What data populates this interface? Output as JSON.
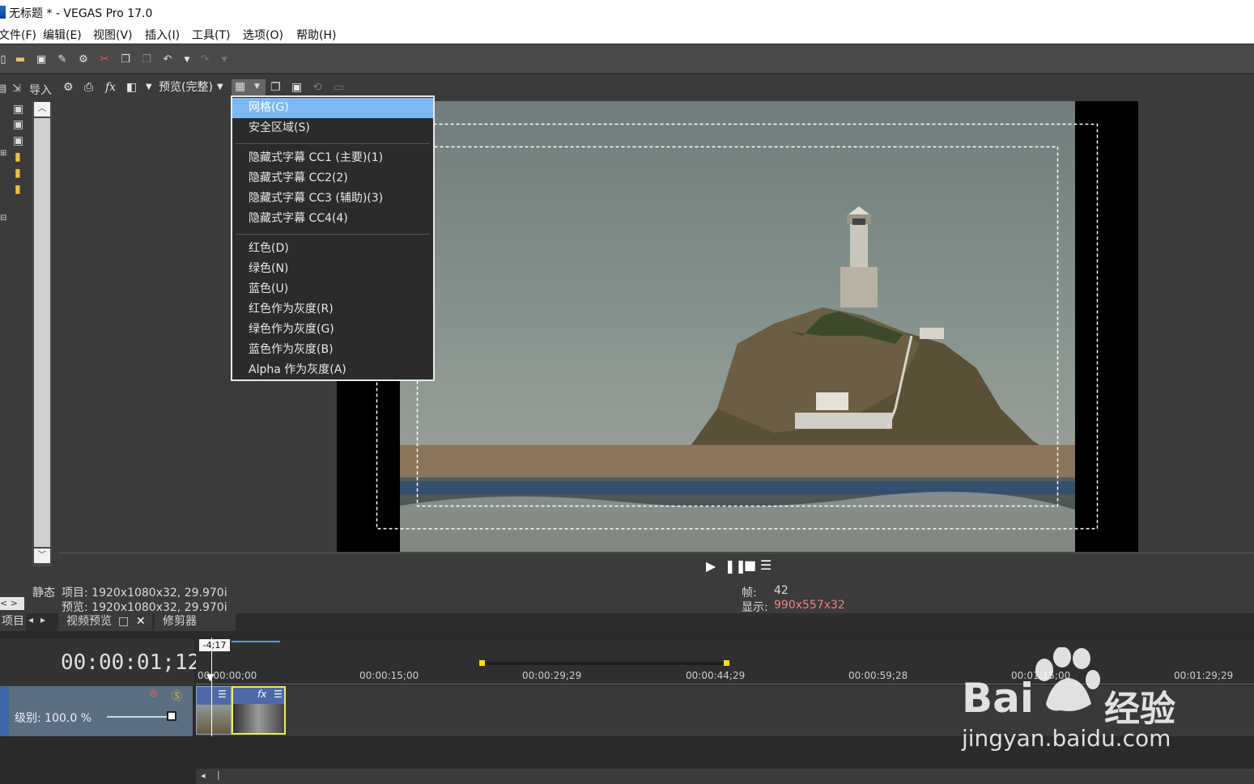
{
  "window": {
    "title": "无标题 * - VEGAS Pro 17.0"
  },
  "menu": {
    "items": [
      "文件(F)",
      "编辑(E)",
      "视图(V)",
      "插入(I)",
      "工具(T)",
      "选项(O)",
      "帮助(H)"
    ]
  },
  "toolbar": {
    "icons": [
      "new-icon",
      "open-icon",
      "save-icon",
      "save-as-icon",
      "properties-icon",
      "cut-icon",
      "copy-icon",
      "paste-icon",
      "undo-icon",
      "undo-dropdown-icon",
      "redo-icon",
      "redo-dropdown-icon"
    ]
  },
  "project_panel": {
    "import_label": "导入",
    "static_label": "静态",
    "tab_label": "项目"
  },
  "preview_toolbar": {
    "quality_label": "预览(完整)"
  },
  "overlay_menu": {
    "items": [
      {
        "label": "网格(G)",
        "selected": true,
        "group": 0
      },
      {
        "label": "安全区域(S)",
        "selected": false,
        "group": 0
      },
      {
        "label": "隐藏式字幕 CC1 (主要)(1)",
        "selected": false,
        "group": 1
      },
      {
        "label": "隐藏式字幕 CC2(2)",
        "selected": false,
        "group": 1
      },
      {
        "label": "隐藏式字幕 CC3 (辅助)(3)",
        "selected": false,
        "group": 1
      },
      {
        "label": "隐藏式字幕 CC4(4)",
        "selected": false,
        "group": 1
      },
      {
        "label": "红色(D)",
        "selected": false,
        "group": 2
      },
      {
        "label": "绿色(N)",
        "selected": false,
        "group": 2
      },
      {
        "label": "蓝色(U)",
        "selected": false,
        "group": 2
      },
      {
        "label": "红色作为灰度(R)",
        "selected": false,
        "group": 2
      },
      {
        "label": "绿色作为灰度(G)",
        "selected": false,
        "group": 2
      },
      {
        "label": "蓝色作为灰度(B)",
        "selected": false,
        "group": 2
      },
      {
        "label": "Alpha 作为灰度(A)",
        "selected": false,
        "group": 2
      }
    ]
  },
  "info": {
    "project": "项目: 1920x1080x32, 29.970i",
    "preview": "预览: 1920x1080x32, 29.970i",
    "frame_label": "帧:",
    "frame_value": "42",
    "display_label": "显示:",
    "display_value": "990x557x32"
  },
  "tabs": {
    "video_preview": "视频预览",
    "trimmer": "修剪器"
  },
  "timeline": {
    "timecode": "00:00:01;12",
    "cursor_badge": "-4;17",
    "track_level": "级别: 100.0 %",
    "track_level_fraction": 1.0,
    "ruler_labels": [
      "00:00:00;00",
      "00:00:15;00",
      "00:00:29;29",
      "00:00:44;29",
      "00:00:59;28",
      "00:01:15;00",
      "00:01:29;29"
    ]
  },
  "watermark": {
    "brand": "Bai",
    "brand_suffix": "经验",
    "url": "jingyan.baidu.com"
  },
  "colors": {
    "menu_highlight": "#7cb8f4",
    "display_value": "#f08080",
    "track_header": "#5b6f80"
  }
}
